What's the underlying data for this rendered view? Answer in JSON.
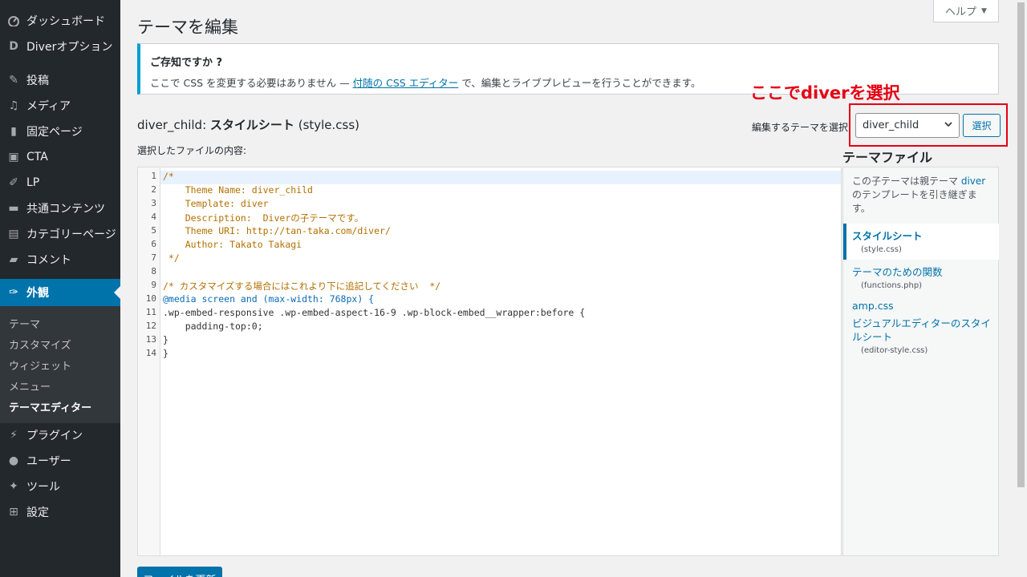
{
  "sidebar": {
    "items": [
      {
        "label": "ダッシュボード",
        "icon": "dashboard-icon"
      },
      {
        "label": "Diverオプション",
        "icon": "diver-icon"
      },
      {
        "label": "投稿",
        "icon": "pin-icon"
      },
      {
        "label": "メディア",
        "icon": "media-icon"
      },
      {
        "label": "固定ページ",
        "icon": "page-icon"
      },
      {
        "label": "CTA",
        "icon": "cta-icon"
      },
      {
        "label": "LP",
        "icon": "lp-icon"
      },
      {
        "label": "共通コンテンツ",
        "icon": "folder-icon"
      },
      {
        "label": "カテゴリーページ",
        "icon": "category-icon"
      },
      {
        "label": "コメント",
        "icon": "comment-icon"
      },
      {
        "label": "外観",
        "icon": "brush-icon"
      },
      {
        "label": "プラグイン",
        "icon": "plugin-icon"
      },
      {
        "label": "ユーザー",
        "icon": "user-icon"
      },
      {
        "label": "ツール",
        "icon": "wrench-icon"
      },
      {
        "label": "設定",
        "icon": "settings-icon"
      }
    ],
    "submenu": [
      "テーマ",
      "カスタマイズ",
      "ウィジェット",
      "メニュー",
      "テーマエディター"
    ]
  },
  "header": {
    "title": "テーマを編集",
    "help": "ヘルプ"
  },
  "notice": {
    "title": "ご存知ですか ?",
    "text_before": "ここで CSS を変更する必要はありません —",
    "link": "付随の CSS エディター",
    "text_after": "で、編集とライブプレビューを行うことができます。"
  },
  "callout": "ここでdiverを選択",
  "file_heading": {
    "theme": "diver_child:",
    "name": "スタイルシート",
    "file": "(style.css)"
  },
  "theme_select": {
    "label": "編集するテーマを選択",
    "value": "diver_child",
    "button": "選択"
  },
  "content_label": "選択したファイルの内容:",
  "editor": {
    "line_numbers": [
      "1",
      "2",
      "3",
      "4",
      "5",
      "6",
      "7",
      "8",
      "9",
      "10",
      "11",
      "12",
      "13",
      "14"
    ],
    "lines": [
      "/*",
      "    Theme Name: diver_child",
      "    Template: diver",
      "    Description:  Diverの子テーマです。",
      "    Theme URI: http://tan-taka.com/diver/",
      "    Author: Takato Takagi",
      " */",
      "",
      "/* カスタマイズする場合にはこれより下に追記してください  */",
      "@media screen and (max-width: 768px) {",
      ".wp-embed-responsive .wp-embed-aspect-16-9 .wp-block-embed__wrapper:before {",
      "    padding-top:0;",
      "}",
      "}"
    ]
  },
  "theme_files": {
    "title": "テーマファイル",
    "desc_before": "この子テーマは親テーマ",
    "desc_link": "diver",
    "desc_after": "のテンプレートを引き継ぎます。",
    "files": [
      {
        "label": "スタイルシート",
        "sub": "(style.css)"
      },
      {
        "label": "テーマのための関数",
        "sub": "(functions.php)"
      },
      {
        "label": "amp.css",
        "sub": ""
      },
      {
        "label": "ビジュアルエディターのスタイルシート",
        "sub": "(editor-style.css)"
      }
    ]
  },
  "update_button": "ファイルを更新",
  "colors": {
    "accent": "#0073aa",
    "sidebar": "#23282d",
    "callout": "#e60012"
  }
}
